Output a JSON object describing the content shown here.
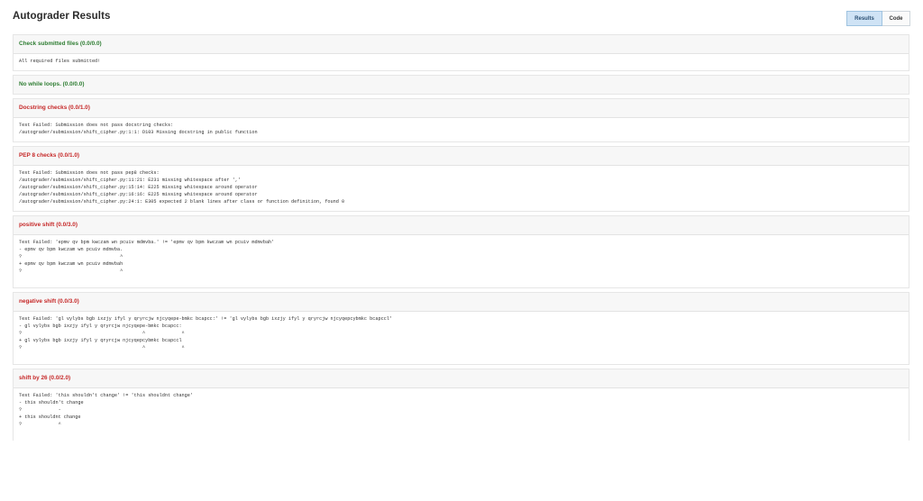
{
  "header": {
    "title": "Autograder Results",
    "toggle_results": "Results",
    "toggle_code": "Code"
  },
  "tests": [
    {
      "title": "Check submitted files (0.0/0.0)",
      "status": "pass",
      "output": "All required files submitted!"
    },
    {
      "title": "No while loops. (0.0/0.0)",
      "status": "pass",
      "output": ""
    },
    {
      "title": "Docstring checks (0.0/1.0)",
      "status": "fail",
      "output": "Test Failed: Submission does not pass docstring checks:\n/autograder/submission/shift_cipher.py:1:1: D103 Missing docstring in public function"
    },
    {
      "title": "PEP 8 checks (0.0/1.0)",
      "status": "fail",
      "output": "Test Failed: Submission does not pass pep8 checks:\n/autograder/submission/shift_cipher.py:11:21: E231 missing whitespace after ','\n/autograder/submission/shift_cipher.py:15:14: E225 missing whitespace around operator\n/autograder/submission/shift_cipher.py:16:16: E225 missing whitespace around operator\n/autograder/submission/shift_cipher.py:24:1: E305 expected 2 blank lines after class or function definition, found 0"
    },
    {
      "title": "positive shift (0.0/3.0)",
      "status": "fail",
      "output": "Test Failed: 'epmv qv bpm kwczam wn pcuiv mdmvba.' != 'epmv qv bpm kwczam wn pcuiv mdmvbah'\n- epmv qv bpm kwczam wn pcuiv mdmvba.\n?                                   ^\n+ epmv qv bpm kwczam wn pcuiv mdmvbah\n?                                   ^"
    },
    {
      "title": "negative shift (0.0/3.0)",
      "status": "fail",
      "output": "Test Failed: 'gl vylybs bgb ixzjy ifyl y qryrcjw njcyqepe-bmkc bcapcc:' != 'gl vylybs bgb ixzjy ifyl y qryrcjw njcyqepcybmkc bcapccl'\n- gl vylybs bgb ixzjy ifyl y qryrcjw njcyqepe-bmkc bcapcc:\n?                                           ^             ^\n+ gl vylybs bgb ixzjy ifyl y qryrcjw njcyqepcybmkc bcapccl\n?                                           ^             ^"
    },
    {
      "title": "shift by 26 (0.0/2.0)",
      "status": "fail",
      "output": "Test Failed: 'this shouldn't change' != 'this shouldnt change'\n- this shouldn't change\n?             -\n+ this shouldnt change\n?             ^"
    }
  ]
}
